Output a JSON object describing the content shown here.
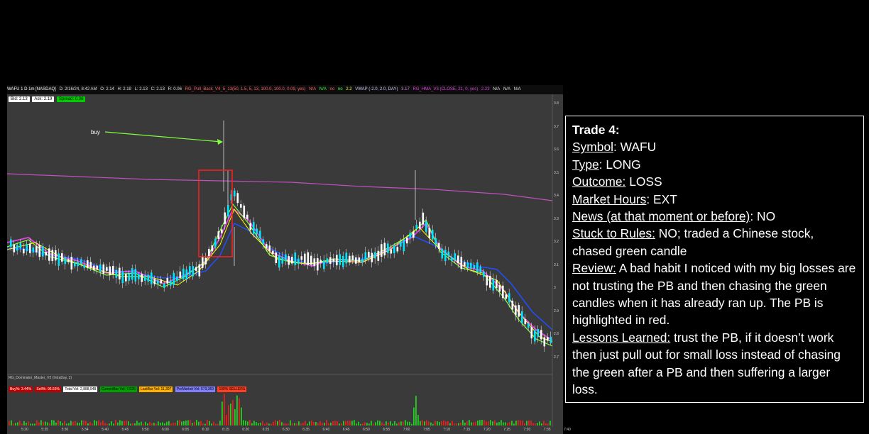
{
  "chart_header": {
    "symbol": "WAFU 1 D 1m [NASDAQ]",
    "date": "D: 2/16/24, 8:42 AM",
    "open": "O: 2.14",
    "high": "H: 2.19",
    "low": "L: 2.13",
    "close": "C: 2.13",
    "range": "R: 0.06",
    "study1": "RG_Pull_Back_V4_5_13(50, 1.5, 5, 13, 100.0, 100.0, 0.09, yes)",
    "na1": "N/A",
    "na2": "N/A",
    "no1": "no",
    "no2": "no",
    "val1": "2.2",
    "vwap": "VWAP (-2.0, 2.0, DAY)",
    "vwap_val": "3.17",
    "hma": "RG_HMA_V3 (CLOSE, 21, 0, yes)",
    "hma_val": "2.23",
    "na3": "N/A",
    "na4": "N/A",
    "na5": "N/A"
  },
  "quote": {
    "bid": "Bid: 2.13",
    "ask": "Ask: 2.19",
    "spread": "Spread: 0.06"
  },
  "annotation": {
    "buy": "buy"
  },
  "volume_header": "RG_Dominator_Master_V2 (IntraDay, 2)",
  "volume_stats": {
    "buy_pct": "Buy%: 3.44%",
    "sell_pct": "Sell%: 96.56%",
    "total_vol": "Total Vol: 2,888,948",
    "current_bar": "CurrentBar Vol: 7,026",
    "last_bar": "LastBar Vol: 11,397",
    "premarket": "PreMarket Vol: 573,369",
    "sellers": "100% SELLERS"
  },
  "colors": {
    "bull": "#00e5ff",
    "bear": "#ffffff",
    "vwap": "#c050c0",
    "ema_fast": "#e040e0",
    "ema_slow": "#2050ff",
    "signal": "#ffff00",
    "green_line": "#80ff40",
    "highlight": "#ff2020"
  },
  "price_axis": [
    "3.8",
    "3.7",
    "3.6",
    "3.5",
    "3.4",
    "3.3",
    "3.2",
    "3.1",
    "3",
    "2.9",
    "2.8",
    "2.7"
  ],
  "time_axis": [
    "5:20",
    "5:25",
    "5:30",
    "5:34",
    "5:40",
    "5:45",
    "5:50",
    "6:00",
    "6:05",
    "6:10",
    "6:15",
    "6:20",
    "6:25",
    "6:30",
    "6:35",
    "6:40",
    "6:45",
    "6:50",
    "6:55",
    "7:00",
    "7:05",
    "7:10",
    "7:15",
    "7:20",
    "7:25",
    "7:30",
    "7:35",
    "7:40"
  ],
  "notes": {
    "title": "Trade  4:",
    "symbol_label": "Symbol",
    "symbol_value": ": WAFU",
    "type_label": "Type",
    "type_value": ": LONG",
    "outcome_label": "Outcome:",
    "outcome_value": " LOSS",
    "hours_label": "Market Hours",
    "hours_value": ": EXT",
    "news_label": "News (at that moment or before)",
    "news_value": ": NO",
    "rules_label": "Stuck to Rules:",
    "rules_value": "  NO; traded a Chinese stock, chased green candle",
    "review_label": "Review:",
    "review_value": "  A bad habit I noticed with my big losses are not trusting the PB and then chasing the green candles when it has already ran up.  The PB  is highlighted in red.",
    "lessons_label": "Lessons Learned:",
    "lessons_value": "  trust the PB, if it doesn’t work then just pull out for small loss instead of chasing the green after a PB and then suffering a larger loss."
  }
}
